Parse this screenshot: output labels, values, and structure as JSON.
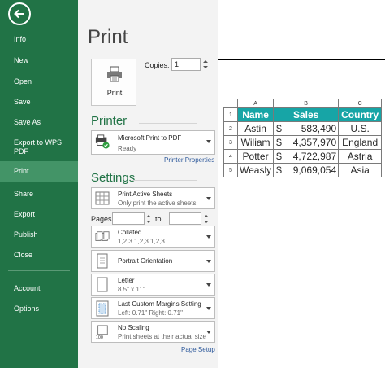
{
  "nav": {
    "items": [
      {
        "id": "info",
        "label": "Info"
      },
      {
        "id": "new",
        "label": "New"
      },
      {
        "id": "open",
        "label": "Open"
      },
      {
        "id": "save",
        "label": "Save"
      },
      {
        "id": "save-as",
        "label": "Save As"
      },
      {
        "id": "export-wps",
        "label": "Export to WPS PDF"
      },
      {
        "id": "print",
        "label": "Print",
        "active": true
      },
      {
        "id": "share",
        "label": "Share"
      },
      {
        "id": "export",
        "label": "Export"
      },
      {
        "id": "publish",
        "label": "Publish"
      },
      {
        "id": "close",
        "label": "Close"
      },
      {
        "id": "account",
        "label": "Account"
      },
      {
        "id": "options",
        "label": "Options"
      }
    ],
    "back_icon": "back-arrow-icon"
  },
  "print": {
    "title": "Print",
    "print_button_label": "Print",
    "copies_label": "Copies:",
    "copies_value": "1"
  },
  "printer": {
    "heading": "Printer",
    "name": "Microsoft Print to PDF",
    "status": "Ready",
    "properties_link": "Printer Properties"
  },
  "settings": {
    "heading": "Settings",
    "scope": {
      "main": "Print Active Sheets",
      "sub": "Only print the active sheets"
    },
    "pages_label": "Pages:",
    "to_label": "to",
    "collation": {
      "main": "Collated",
      "sub": "1,2,3    1,2,3    1,2,3"
    },
    "orientation": {
      "main": "Portrait Orientation"
    },
    "paper": {
      "main": "Letter",
      "sub": "8.5\" x 11\""
    },
    "margins": {
      "main": "Last Custom Margins Setting",
      "sub": "Left:  0.71\"    Right:  0.71\""
    },
    "scaling": {
      "main": "No Scaling",
      "sub": "Print sheets at their actual size"
    },
    "page_setup_link": "Page Setup"
  },
  "preview": {
    "column_letters": [
      "A",
      "B",
      "C"
    ],
    "row_numbers": [
      "1",
      "2",
      "3",
      "4",
      "5"
    ],
    "headers": [
      "Name",
      "Sales",
      "Country"
    ],
    "rows": [
      {
        "name": "Astin",
        "currency": "$",
        "sales": "583,490",
        "country": "U.S."
      },
      {
        "name": "Wiliam",
        "currency": "$",
        "sales": "4,357,970",
        "country": "England"
      },
      {
        "name": "Potter",
        "currency": "$",
        "sales": "4,722,987",
        "country": "Astria"
      },
      {
        "name": "Weasly",
        "currency": "$",
        "sales": "9,069,054",
        "country": "Asia"
      }
    ],
    "header_color": "#17a5a6"
  },
  "colors": {
    "nav_bg": "#217346",
    "nav_active": "#439467",
    "accent": "#217346",
    "link": "#2b579a"
  }
}
